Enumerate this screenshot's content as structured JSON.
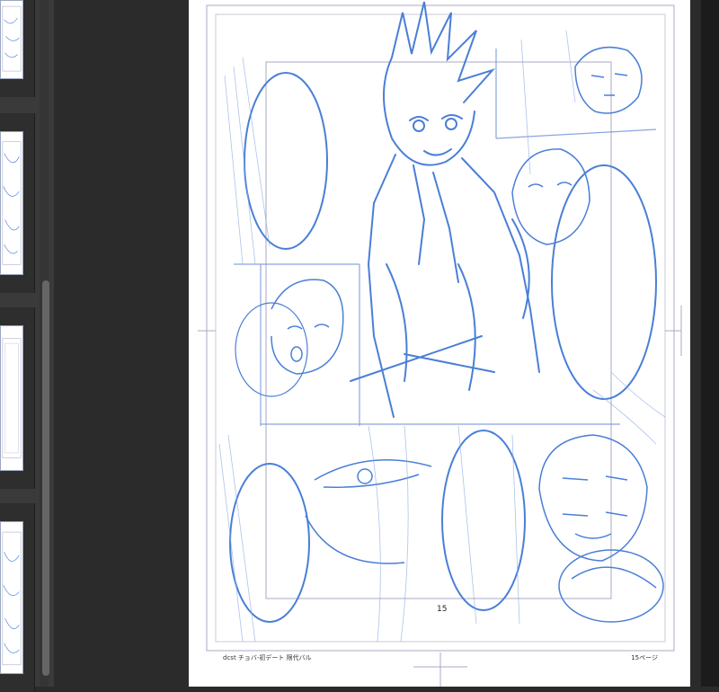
{
  "page": {
    "number_label": "15",
    "folio_left": "dcst チョバ-初デート 限代バル",
    "folio_right": "15ページ"
  },
  "thumbnails": [
    {
      "name": "page-13"
    },
    {
      "name": "page-14"
    },
    {
      "name": "page-15"
    },
    {
      "name": "page-16"
    }
  ],
  "colors": {
    "sketch": "#4a7fd6",
    "guide": "#a8aac4",
    "background": "#2b2b2b",
    "sidebar": "#3a3a3a"
  }
}
